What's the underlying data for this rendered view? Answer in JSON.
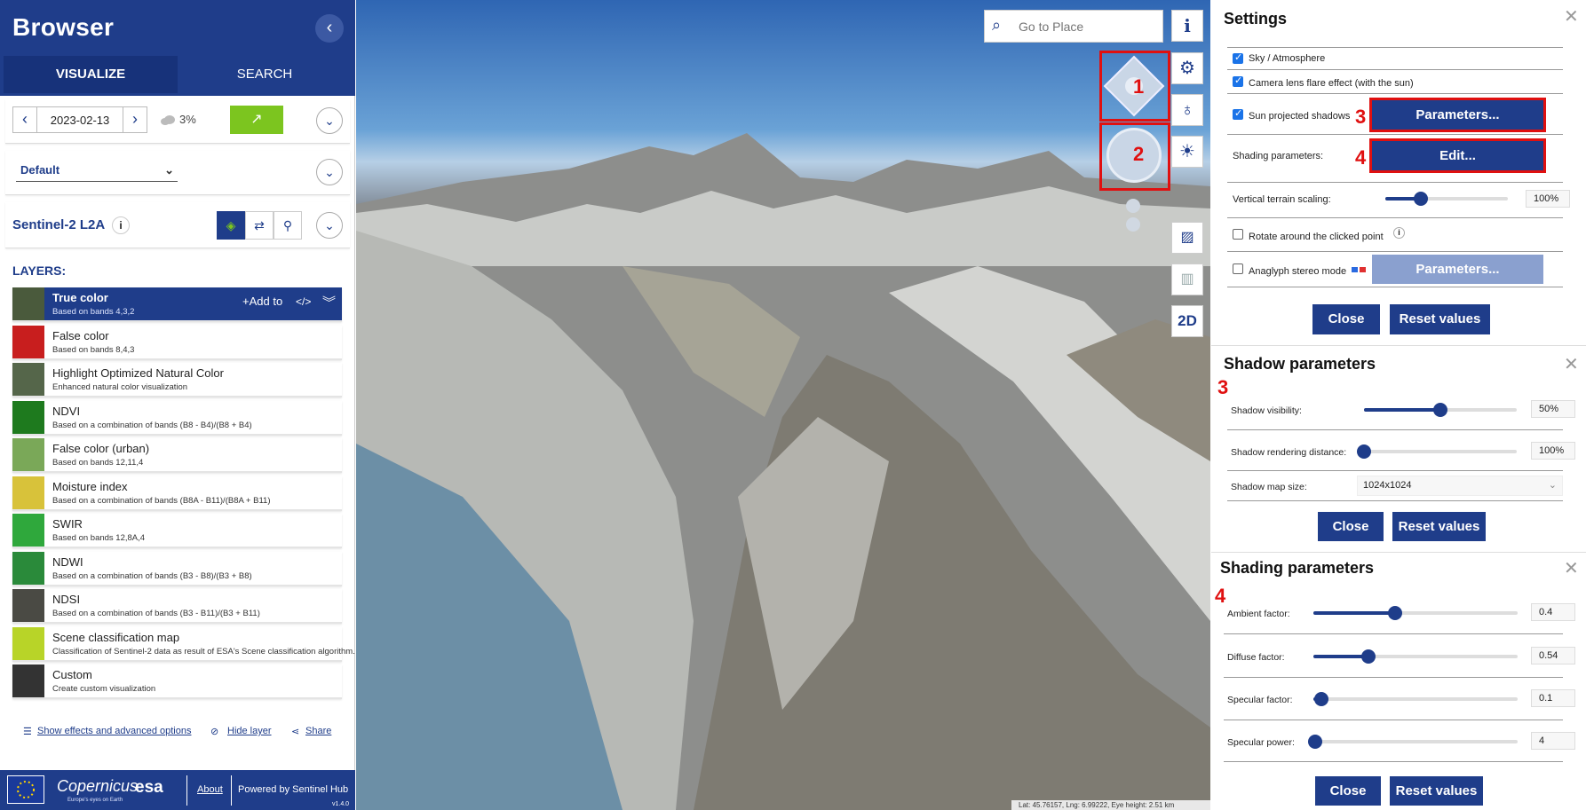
{
  "sidebar": {
    "title": "Browser",
    "collapse_icon": "chevron-left-icon",
    "tabs": [
      "VISUALIZE",
      "SEARCH"
    ],
    "date": "2023-02-13",
    "cloud": "3%",
    "preset": "Default",
    "dataset": "Sentinel-2 L2A",
    "layers_heading": "LAYERS:",
    "add_to": "Add to",
    "layers": [
      {
        "name": "True color",
        "desc": "Based on bands 4,3,2",
        "color": "#4a5a3c"
      },
      {
        "name": "False color",
        "desc": "Based on bands 8,4,3",
        "color": "#c81e1e"
      },
      {
        "name": "Highlight Optimized Natural Color",
        "desc": "Enhanced natural color visualization",
        "color": "#55664a"
      },
      {
        "name": "NDVI",
        "desc": "Based on a combination of bands (B8 - B4)/(B8 + B4)",
        "color": "#1e7a1e"
      },
      {
        "name": "False color (urban)",
        "desc": "Based on bands 12,11,4",
        "color": "#7aa858"
      },
      {
        "name": "Moisture index",
        "desc": "Based on a combination of bands (B8A - B11)/(B8A + B11)",
        "color": "#d8c23a"
      },
      {
        "name": "SWIR",
        "desc": "Based on bands 12,8A,4",
        "color": "#2fa83c"
      },
      {
        "name": "NDWI",
        "desc": "Based on a combination of bands (B3 - B8)/(B3 + B8)",
        "color": "#2a8a3a"
      },
      {
        "name": "NDSI",
        "desc": "Based on a combination of bands (B3 - B11)/(B3 + B11)",
        "color": "#4a4a44"
      },
      {
        "name": "Scene classification map",
        "desc": "Classification of Sentinel-2 data as result of ESA's Scene classification algorithm.",
        "color": "#b8d428"
      },
      {
        "name": "Custom",
        "desc": "Create custom visualization",
        "color": "#333333"
      }
    ],
    "footer": {
      "effects": "Show effects and advanced options",
      "hide": "Hide layer",
      "share": "Share"
    },
    "bottom": {
      "about": "About",
      "powered": "Powered by Sentinel Hub",
      "version": "v1.4.0",
      "logo_copernicus": "Copernicus",
      "logo_copernicus_sub": "Europe's eyes on Earth",
      "logo_esa": "esa"
    }
  },
  "map": {
    "search_placeholder": "Go to Place",
    "mode_2d": "2D",
    "status": "Lat: 45.76157, Lng: 6.99222, Eye height: 2.51 km",
    "annotations": [
      "1",
      "2"
    ]
  },
  "settings": {
    "title": "Settings",
    "sky": "Sky / Atmosphere",
    "flare": "Camera lens flare effect (with the sun)",
    "shadows": "Sun projected shadows",
    "parameters_btn": "Parameters...",
    "shading_label": "Shading parameters:",
    "edit_btn": "Edit...",
    "vertical_label": "Vertical terrain scaling:",
    "vertical_value": "100%",
    "vertical_frac": 0.29,
    "rotate": "Rotate around the clicked point",
    "anaglyph": "Anaglyph stereo mode",
    "anaglyph_btn": "Parameters...",
    "close": "Close",
    "reset": "Reset values",
    "ann3": "3",
    "ann4": "4"
  },
  "shadow": {
    "title": "Shadow parameters",
    "ann": "3",
    "visibility_label": "Shadow visibility:",
    "visibility_value": "50%",
    "visibility_frac": 0.5,
    "distance_label": "Shadow rendering distance:",
    "distance_value": "100%",
    "distance_frac": 0.0,
    "mapsize_label": "Shadow map size:",
    "mapsize_value": "1024x1024",
    "close": "Close",
    "reset": "Reset values"
  },
  "shading": {
    "title": "Shading parameters",
    "ann": "4",
    "ambient_label": "Ambient factor:",
    "ambient_value": "0.4",
    "ambient_frac": 0.4,
    "diffuse_label": "Diffuse factor:",
    "diffuse_value": "0.54",
    "diffuse_frac": 0.27,
    "specular_label": "Specular factor:",
    "specular_value": "0.1",
    "specular_frac": 0.04,
    "power_label": "Specular power:",
    "power_value": "4",
    "power_frac": 0.01,
    "close": "Close",
    "reset": "Reset values"
  }
}
